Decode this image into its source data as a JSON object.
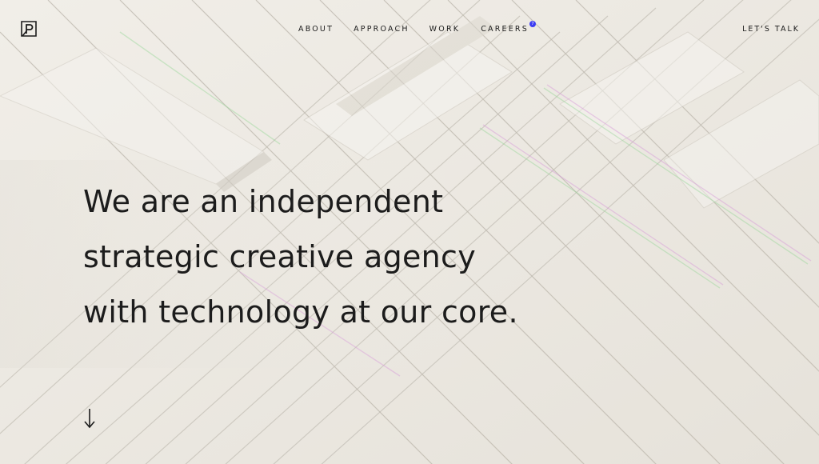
{
  "nav": {
    "items": [
      {
        "label": "ABOUT"
      },
      {
        "label": "APPROACH"
      },
      {
        "label": "WORK"
      },
      {
        "label": "CAREERS"
      }
    ],
    "careers_badge": "7",
    "cta_label": "LET'S TALK"
  },
  "hero": {
    "lines": [
      "We are an independent",
      "strategic creative agency",
      "with technology at our core."
    ]
  },
  "colors": {
    "background": "#ece9e2",
    "text": "#1c1c1c",
    "badge": "#3d3df2"
  },
  "icons": {
    "logo": "agency-logo-icon",
    "scroll": "arrow-down-icon"
  }
}
